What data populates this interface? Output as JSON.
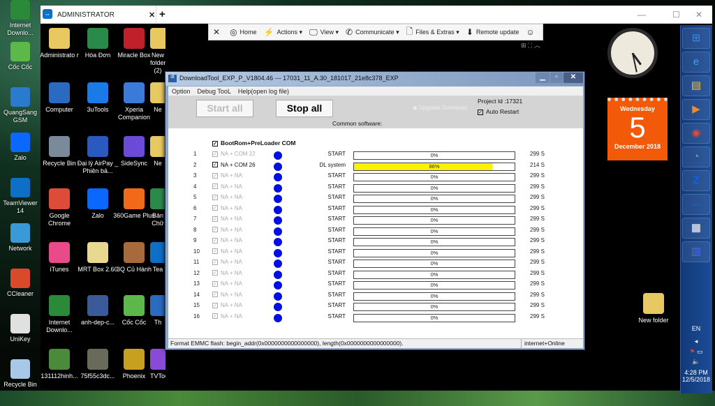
{
  "desktop_left": [
    {
      "label": "Internet Downlo...",
      "icon": "idm-icon",
      "color": "#2a8a3a"
    },
    {
      "label": "Cốc Cốc",
      "icon": "coccoc-icon",
      "color": "#5db84a"
    },
    {
      "label": "QuangSang GSM",
      "icon": "computer-icon",
      "color": "#2a7ad0"
    },
    {
      "label": "Zalo",
      "icon": "zalo-icon",
      "color": "#0a68ff"
    },
    {
      "label": "TeamViewer 14",
      "icon": "teamviewer-icon",
      "color": "#0e6fc7"
    },
    {
      "label": "Network",
      "icon": "network-icon",
      "color": "#3a9ad8"
    },
    {
      "label": "CCleaner",
      "icon": "ccleaner-icon",
      "color": "#d84a2a"
    },
    {
      "label": "UniKey",
      "icon": "unikey-icon",
      "color": "#e0e0e0"
    },
    {
      "label": "Recycle Bin",
      "icon": "recycle-bin-icon",
      "color": "#a8c8e8"
    }
  ],
  "desktop_grid": [
    {
      "label": "Administrato r",
      "icon": "user-folder-icon",
      "color": "#e8c860"
    },
    {
      "label": "Hóa Đơn",
      "icon": "excel-icon",
      "color": "#2a8a4a"
    },
    {
      "label": "Miracle Box",
      "icon": "miracle-box-icon",
      "color": "#c0202a"
    },
    {
      "label": "New folder (2)",
      "icon": "folder-icon",
      "color": "#e8c860"
    },
    {
      "label": "Computer",
      "icon": "computer-icon",
      "color": "#2a6ac0"
    },
    {
      "label": "3uTools",
      "icon": "3utools-icon",
      "color": "#1a7ae8"
    },
    {
      "label": "Xperia Companion",
      "icon": "xperia-icon",
      "color": "#3a7ad8"
    },
    {
      "label": "Ne",
      "icon": "folder-icon",
      "color": "#e8c860"
    },
    {
      "label": "Recycle Bin",
      "icon": "recycle-bin-icon",
      "color": "#7a8a9a"
    },
    {
      "label": "Đại lý AirPay _ Phiên bả...",
      "icon": "airpay-icon",
      "color": "#2a5ac0"
    },
    {
      "label": "SideSync",
      "icon": "sidesync-icon",
      "color": "#6a4ad8"
    },
    {
      "label": "Ne",
      "icon": "folder-icon",
      "color": "#e8c860"
    },
    {
      "label": "Google Chrome",
      "icon": "chrome-icon",
      "color": "#dd4b39"
    },
    {
      "label": "Zalo",
      "icon": "zalo-icon",
      "color": "#0a68ff"
    },
    {
      "label": "360Game Plus",
      "icon": "360game-icon",
      "color": "#f06a1a"
    },
    {
      "label": "Bản Chữ",
      "icon": "excel-icon",
      "color": "#2a8a4a"
    },
    {
      "label": "iTunes",
      "icon": "itunes-icon",
      "color": "#e84a8a"
    },
    {
      "label": "MRT Box 2.60",
      "icon": "folder-icon",
      "color": "#e8d890"
    },
    {
      "label": "3Q Củ Hành",
      "icon": "game-icon",
      "color": "#a86a3a"
    },
    {
      "label": "Tea",
      "icon": "teamviewer-icon",
      "color": "#0e6fc7"
    },
    {
      "label": "Internet Downlo...",
      "icon": "idm-icon",
      "color": "#2a8a3a"
    },
    {
      "label": "anh-dep-c...",
      "icon": "image-icon",
      "color": "#3a5a9a"
    },
    {
      "label": "Cốc Cốc",
      "icon": "coccoc-icon",
      "color": "#5db84a"
    },
    {
      "label": "Th",
      "icon": "app-icon",
      "color": "#2a6ac0"
    },
    {
      "label": "131112hinh...",
      "icon": "image-icon",
      "color": "#4a8a3a"
    },
    {
      "label": "75f55c3dc...",
      "icon": "image-icon",
      "color": "#6a6a5a"
    },
    {
      "label": "Phoenix",
      "icon": "phoenix-icon",
      "color": "#c8a020"
    },
    {
      "label": "TVTools_Al...",
      "icon": "tvtools-icon",
      "color": "#8a4ad8"
    }
  ],
  "desktop_right": {
    "label": "New folder",
    "icon": "folder-icon"
  },
  "teamviewer": {
    "tab_label": "ADMINISTRATOR",
    "tab_close": "✕",
    "new_tab": "+",
    "toolbar": [
      {
        "label": "",
        "icon": "close-icon",
        "glyph": "✕"
      },
      {
        "label": "Home",
        "icon": "home-icon",
        "glyph": "◎"
      },
      {
        "label": "Actions ▾",
        "icon": "lightning-icon",
        "glyph": "⚡"
      },
      {
        "label": "View ▾",
        "icon": "monitor-icon",
        "glyph": "🖵"
      },
      {
        "label": "Communicate ▾",
        "icon": "phone-icon",
        "glyph": "✆"
      },
      {
        "label": "Files & Extras ▾",
        "icon": "file-icon",
        "glyph": "🗋"
      },
      {
        "label": "Remote update",
        "icon": "download-icon",
        "glyph": "⬇"
      },
      {
        "label": "",
        "icon": "smiley-icon",
        "glyph": "☺"
      }
    ]
  },
  "clock": {
    "time": "4:28"
  },
  "calendar": {
    "weekday": "Wednesday",
    "day": "5",
    "month_year": "December 2018"
  },
  "taskbar": {
    "buttons": [
      {
        "icon": "start-orb-icon",
        "glyph": "⊞",
        "color": "#3a8ae8"
      },
      {
        "icon": "ie-icon",
        "glyph": "e",
        "color": "#3aa0f0"
      },
      {
        "icon": "explorer-icon",
        "glyph": "▤",
        "color": "#f0c040"
      },
      {
        "icon": "media-player-icon",
        "glyph": "▶",
        "color": "#f08a2a"
      },
      {
        "icon": "chrome-icon",
        "glyph": "◉",
        "color": "#dd4b39"
      },
      {
        "icon": "coccoc-icon",
        "glyph": "◔",
        "color": "#5db84a"
      },
      {
        "icon": "zalo-icon",
        "glyph": "Z",
        "color": "#0a68ff"
      },
      {
        "icon": "teamviewer-icon",
        "glyph": "⇔",
        "color": "#0e6fc7"
      },
      {
        "icon": "app-maze-icon",
        "glyph": "▦",
        "color": "#ffffff"
      },
      {
        "icon": "building-icon",
        "glyph": "▥",
        "color": "#4a6af0"
      }
    ],
    "language": "EN",
    "time": "4:28 PM",
    "date": "12/5/2018"
  },
  "download_tool": {
    "title": "DownloadTool_EXP_P_V1804.46 --- 17031_11_A.30_181017_21e8c378_EXP",
    "menu": [
      "Option",
      "Debug TooL",
      "Help(open log file)"
    ],
    "start_all": "Start all",
    "stop_all": "Stop all",
    "upgrade_download": "Upgrade Download",
    "project_id": "Project Id :17321",
    "auto_restart": "Auto Restart",
    "auto_restart_checked": true,
    "common_software": "Common software:",
    "bootrom_label": "BootRom+PreLoader COM",
    "rows": [
      {
        "n": "1",
        "port": "NA + COM 22",
        "enabled": false,
        "status": "START",
        "progress": 0,
        "pct": "0%",
        "time": "299 S"
      },
      {
        "n": "2",
        "port": "NA + COM 26",
        "enabled": true,
        "status": "DL system",
        "progress": 86,
        "pct": "86%",
        "time": "214 S"
      },
      {
        "n": "3",
        "port": "NA + NA",
        "enabled": false,
        "status": "START",
        "progress": 0,
        "pct": "0%",
        "time": "299 S"
      },
      {
        "n": "4",
        "port": "NA + NA",
        "enabled": false,
        "status": "START",
        "progress": 0,
        "pct": "0%",
        "time": "299 S"
      },
      {
        "n": "5",
        "port": "NA + NA",
        "enabled": false,
        "status": "START",
        "progress": 0,
        "pct": "0%",
        "time": "299 S"
      },
      {
        "n": "6",
        "port": "NA + NA",
        "enabled": false,
        "status": "START",
        "progress": 0,
        "pct": "0%",
        "time": "299 S"
      },
      {
        "n": "7",
        "port": "NA + NA",
        "enabled": false,
        "status": "START",
        "progress": 0,
        "pct": "0%",
        "time": "299 S"
      },
      {
        "n": "8",
        "port": "NA + NA",
        "enabled": false,
        "status": "START",
        "progress": 0,
        "pct": "0%",
        "time": "299 S"
      },
      {
        "n": "9",
        "port": "NA + NA",
        "enabled": false,
        "status": "START",
        "progress": 0,
        "pct": "0%",
        "time": "299 S"
      },
      {
        "n": "10",
        "port": "NA + NA",
        "enabled": false,
        "status": "START",
        "progress": 0,
        "pct": "0%",
        "time": "299 S"
      },
      {
        "n": "11",
        "port": "NA + NA",
        "enabled": false,
        "status": "START",
        "progress": 0,
        "pct": "0%",
        "time": "299 S"
      },
      {
        "n": "12",
        "port": "NA + NA",
        "enabled": false,
        "status": "START",
        "progress": 0,
        "pct": "0%",
        "time": "299 S"
      },
      {
        "n": "13",
        "port": "NA + NA",
        "enabled": false,
        "status": "START",
        "progress": 0,
        "pct": "0%",
        "time": "299 S"
      },
      {
        "n": "14",
        "port": "NA + NA",
        "enabled": false,
        "status": "START",
        "progress": 0,
        "pct": "0%",
        "time": "299 S"
      },
      {
        "n": "15",
        "port": "NA + NA",
        "enabled": false,
        "status": "START",
        "progress": 0,
        "pct": "0%",
        "time": "299 S"
      },
      {
        "n": "16",
        "port": "NA + NA",
        "enabled": false,
        "status": "START",
        "progress": 0,
        "pct": "0%",
        "time": "299 S"
      }
    ],
    "status_msg": "Format EMMC flash:  begin_addr(0x0000000000000000), length(0x0000000000000000).",
    "status_net": "internet+Online",
    "colors": {
      "progress_fill": "#fff200",
      "dot": "#0010e0"
    }
  }
}
